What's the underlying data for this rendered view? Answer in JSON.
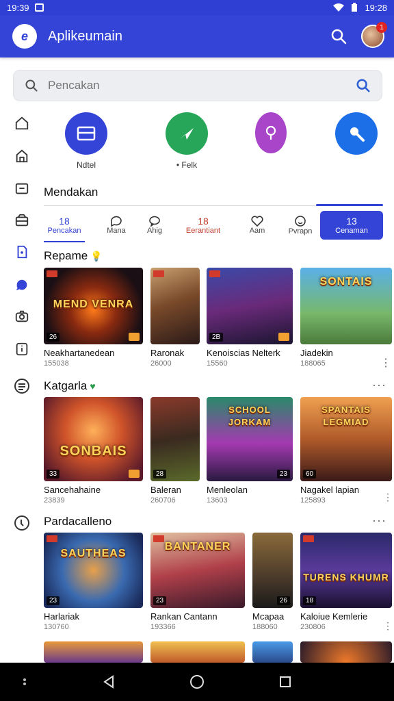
{
  "status_bar": {
    "time": "19:39",
    "clock_right": "19:28"
  },
  "app_bar": {
    "logo_letter": "e",
    "title": "Aplikeumain",
    "notification_count": "1"
  },
  "search": {
    "placeholder": "Pencakan"
  },
  "shortcuts": [
    {
      "label": "Ndtel",
      "color": "#3344d6",
      "icon": "window-icon"
    },
    {
      "label": "• Felk",
      "color": "#27a65a",
      "icon": "send-icon"
    },
    {
      "label": "",
      "color": "#a845c8",
      "icon": "pin-icon"
    },
    {
      "label": "",
      "color": "#1d6fe8",
      "icon": "key-icon"
    }
  ],
  "section_main": {
    "title": "Mendakan"
  },
  "tabs": [
    {
      "num": "18",
      "label": "Pencakan",
      "icon": "",
      "style": "active-first"
    },
    {
      "num": "",
      "label": "Mana",
      "icon": "chat-icon",
      "style": ""
    },
    {
      "num": "",
      "label": "Ahig",
      "icon": "bubble-icon",
      "style": ""
    },
    {
      "num": "18",
      "label": "Eerantiant",
      "icon": "",
      "style": "red"
    },
    {
      "num": "",
      "label": "Aam",
      "icon": "heart-icon",
      "style": ""
    },
    {
      "num": "",
      "label": "Pvrapn",
      "icon": "face-icon",
      "style": ""
    },
    {
      "num": "13",
      "label": "Cenaman",
      "icon": "",
      "style": "pill"
    }
  ],
  "sections": [
    {
      "title": "Repame",
      "badge": "💡",
      "cards": [
        {
          "name": "Neakhartanedean",
          "sub": "155038",
          "art": "MEND VENRA",
          "count": "26"
        },
        {
          "name": "Raronak",
          "sub": "26000",
          "art": "",
          "count": ""
        },
        {
          "name": "Kenoiscias Nelterk",
          "sub": "15560",
          "art": "",
          "count": "2B"
        },
        {
          "name": "Jiadekin",
          "sub": "188065",
          "art": "SONTAIS",
          "count": ""
        }
      ]
    },
    {
      "title": "Katgarla",
      "badge": "♥",
      "cards": [
        {
          "name": "Sancehahaine",
          "sub": "23839",
          "art": "SONBAIS",
          "count": "33"
        },
        {
          "name": "Baleran",
          "sub": "260706",
          "art": "",
          "count": "28"
        },
        {
          "name": "Menleolan",
          "sub": "13603",
          "art": "SCHOOL JORKAM",
          "count": "23"
        },
        {
          "name": "Nagakel lapian",
          "sub": "125893",
          "art": "SPANTAIS LEGMIAD",
          "count": "60"
        }
      ]
    },
    {
      "title": "Pardacalleno",
      "badge": "",
      "cards": [
        {
          "name": "Harlariak",
          "sub": "130760",
          "art": "SAUTHEAS",
          "count": "23"
        },
        {
          "name": "Rankan Cantann",
          "sub": "193366",
          "art": "BANTANER",
          "count": "23"
        },
        {
          "name": "Mcapaa",
          "sub": "188060",
          "art": "",
          "count": "26"
        },
        {
          "name": "Kaloiue Kemlerie",
          "sub": "230806",
          "art": "TURENS KHUMR",
          "count": "18"
        }
      ]
    }
  ]
}
